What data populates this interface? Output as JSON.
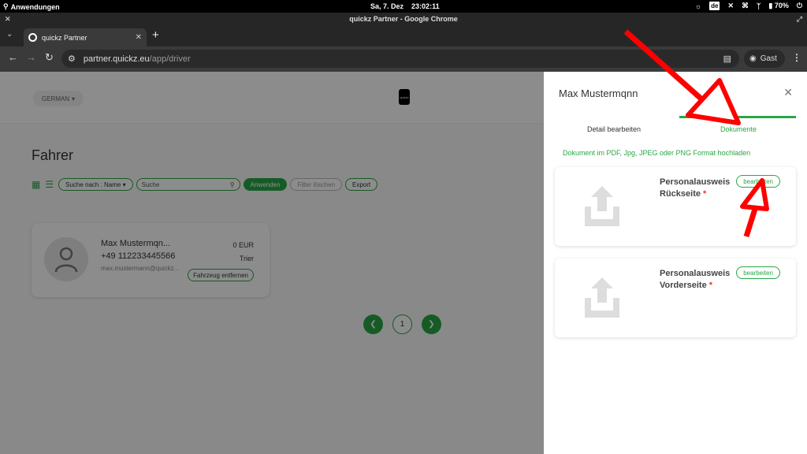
{
  "os": {
    "apps_label": "Anwendungen",
    "date": "Sa, 7. Dez",
    "time": "23:02:11",
    "keyboard_layout": "de",
    "battery": "70%"
  },
  "browser": {
    "window_title": "quickz Partner - Google Chrome",
    "tab_title": "quickz Partner",
    "url_host": "partner.quickz.eu",
    "url_path": "/app/driver",
    "profile_label": "Gast"
  },
  "header": {
    "language": "GERMAN",
    "logo_text": "quickz"
  },
  "main": {
    "title": "Fahrer",
    "toolbar": {
      "search_by": "Suche nach : Name",
      "search_placeholder": "Suche",
      "apply_label": "Anwenden",
      "clear_label": "Filter löschen",
      "export_label": "Export"
    },
    "driver_card": {
      "name": "Max Mustermqn...",
      "phone": "+49 112233445566",
      "email": "max.mustermann@quickz...",
      "amount": "0 EUR",
      "city": "Trier",
      "remove_vehicle_label": "Fahrzeug entfernen"
    },
    "pagination": {
      "current_page": "1"
    }
  },
  "drawer": {
    "title": "Max Mustermqnn",
    "tabs": [
      {
        "label": "Detail bearbeiten"
      },
      {
        "label": "Dokumente"
      }
    ],
    "active_tab": 1,
    "hint": "Dokument im PDF, Jpg, JPEG oder PNG Format hochladen",
    "documents": [
      {
        "line1": "Personalausweis",
        "line2": "Rückseite",
        "required_mark": "*",
        "edit_label": "bearbeiten"
      },
      {
        "line1": "Personalausweis",
        "line2": "Vorderseite",
        "required_mark": "*",
        "edit_label": "bearbeiten"
      }
    ]
  },
  "colors": {
    "accent": "#28a745",
    "annotation": "#ff0000",
    "required": "#e53935"
  }
}
